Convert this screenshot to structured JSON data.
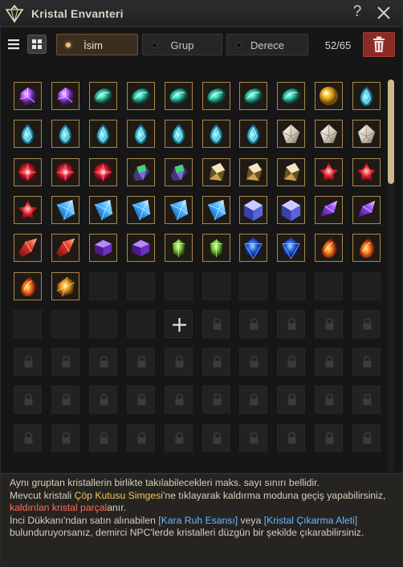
{
  "window": {
    "title": "Kristal Envanteri",
    "help_label": "?"
  },
  "toolbar": {
    "sort_options": [
      {
        "label": "İsim",
        "selected": true
      },
      {
        "label": "Grup",
        "selected": false
      },
      {
        "label": "Derece",
        "selected": false
      }
    ],
    "count": "52/65"
  },
  "icons": {
    "title": "crystal-diamond-icon",
    "help": "question-icon",
    "close": "close-x-icon",
    "list_view": "list-icon",
    "grid_view": "grid-icon",
    "trash": "trash-icon",
    "add": "plus-icon",
    "lock": "lock-icon"
  },
  "colors": {
    "accent_gold": "#ceb88c",
    "trash_red": "#8a2b25",
    "highlight_yellow": "#f1c85a",
    "highlight_red": "#ff6b5a",
    "highlight_blue": "#6bb8ff"
  },
  "grid": {
    "columns": 10,
    "total_slots": 100,
    "add_slot_symbol": "+",
    "crystals": [
      "purple-gem",
      "purple-gem",
      "teal-oval",
      "teal-oval",
      "teal-oval",
      "teal-oval",
      "teal-oval",
      "teal-oval",
      "gold-orb",
      "cyan-drop",
      "cyan-drop",
      "cyan-drop",
      "cyan-drop",
      "cyan-drop",
      "cyan-drop",
      "cyan-drop",
      "cyan-drop",
      "white-pyramid",
      "white-pyramid",
      "white-pyramid",
      "red-round",
      "red-round",
      "red-round",
      "green-purple",
      "green-purple",
      "gold-white",
      "gold-white",
      "gold-white",
      "red-star",
      "red-star",
      "red-star",
      "blue-shard",
      "blue-shard",
      "blue-shard",
      "blue-shard",
      "blue-shard",
      "navy-cube",
      "navy-cube",
      "violet-shard",
      "violet-shard",
      "red-shard",
      "red-shard",
      "purple-hex",
      "purple-hex",
      "green-gem",
      "green-gem",
      "blue-sapphire",
      "blue-sapphire",
      "fire-drop",
      "fire-drop",
      "fire-drop",
      "amber-gem"
    ],
    "empty_slots": 12,
    "add_slots": 1,
    "locked_slots": 35
  },
  "info": {
    "line1": "Aynı gruptan kristallerin birlikte takılabilecekleri maks. sayı sınırı bellidir.",
    "line2_a": "Mevcut kristali ",
    "line2_hl": "Çöp Kutusu Simgesi",
    "line2_b": "'ne tıklayarak kaldırma moduna geçiş yapabilirsiniz, ",
    "line2_red": "kaldırılan kristal parçal",
    "line2_c": "anır.",
    "line3_a": "İnci Dükkanı'ndan satın alınabilen ",
    "line3_hl1": "[Kara Ruh Esansı]",
    "line3_b": " veya ",
    "line3_hl2": "[Kristal Çıkarma Aleti]",
    "line3_c": " bulunduruyorsanız, demirci NPC'lerde kristalleri düzgün bir şekilde çıkarabilirsiniz."
  }
}
